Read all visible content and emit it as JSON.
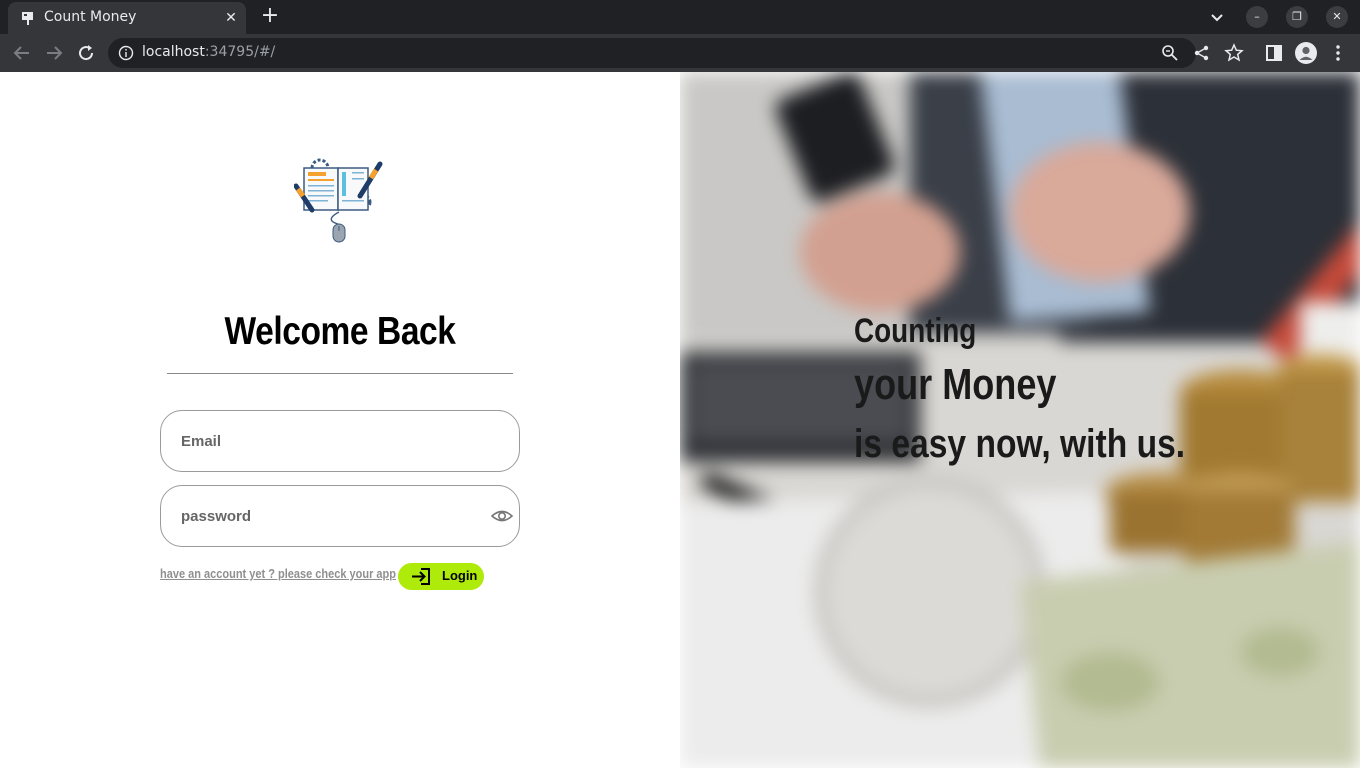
{
  "browser": {
    "tab_title": "Count Money",
    "url_host": "localhost",
    "url_rest": ":34795/#/"
  },
  "login": {
    "title": "Welcome Back",
    "email_placeholder": "Email",
    "password_placeholder": "password",
    "signup_text": "have an account yet ? please check your app",
    "login_label": "Login"
  },
  "hero": {
    "line1": "Counting",
    "line2": "your Money",
    "line3": "is easy now, with us."
  },
  "colors": {
    "accent": "#aeea0a",
    "chrome_dark": "#202124",
    "chrome_toolbar": "#35363a"
  },
  "icons": {
    "logo": "accounting-book-icon",
    "password_toggle": "eye-icon",
    "login": "login-arrow-icon"
  }
}
